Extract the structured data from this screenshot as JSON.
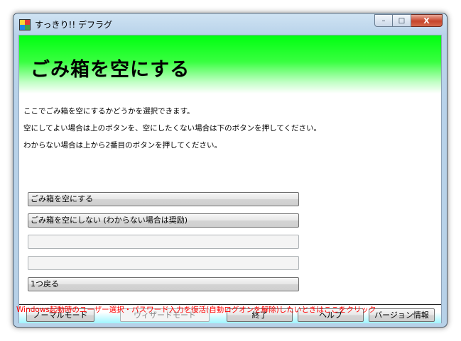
{
  "window": {
    "title": "すっきり!! デフラグ",
    "controls": {
      "minimize": "–",
      "maximize": "□",
      "close": "X"
    }
  },
  "header": {
    "title": "ごみ箱を空にする"
  },
  "description": [
    "ここでごみ箱を空にするかどうかを選択できます。",
    "空にしてよい場合は上のボタンを、空にしたくない場合は下のボタンを押してください。",
    "わからない場合は上から2番目のボタンを押してください。"
  ],
  "choices": [
    {
      "label": "ごみ箱を空にする"
    },
    {
      "label": "ごみ箱を空にしない (わからない場合は奨励)"
    },
    {
      "label": ""
    },
    {
      "label": ""
    },
    {
      "label": "1つ戻る"
    }
  ],
  "bottom_buttons": {
    "normal_mode": "ノーマルモード",
    "wizard_mode": "ウィザードモード",
    "exit": "終了",
    "help": "ヘルプ",
    "version": "バージョン情報"
  },
  "notice": "Windows起動時のユーザー選択・パスワード入力を復活(自動ログオンを解除)したいときはここをクリック",
  "colors": {
    "header_green": "#00ff10",
    "notice_red": "#ff0000",
    "bottom_cyan": "#9ff6ff"
  }
}
